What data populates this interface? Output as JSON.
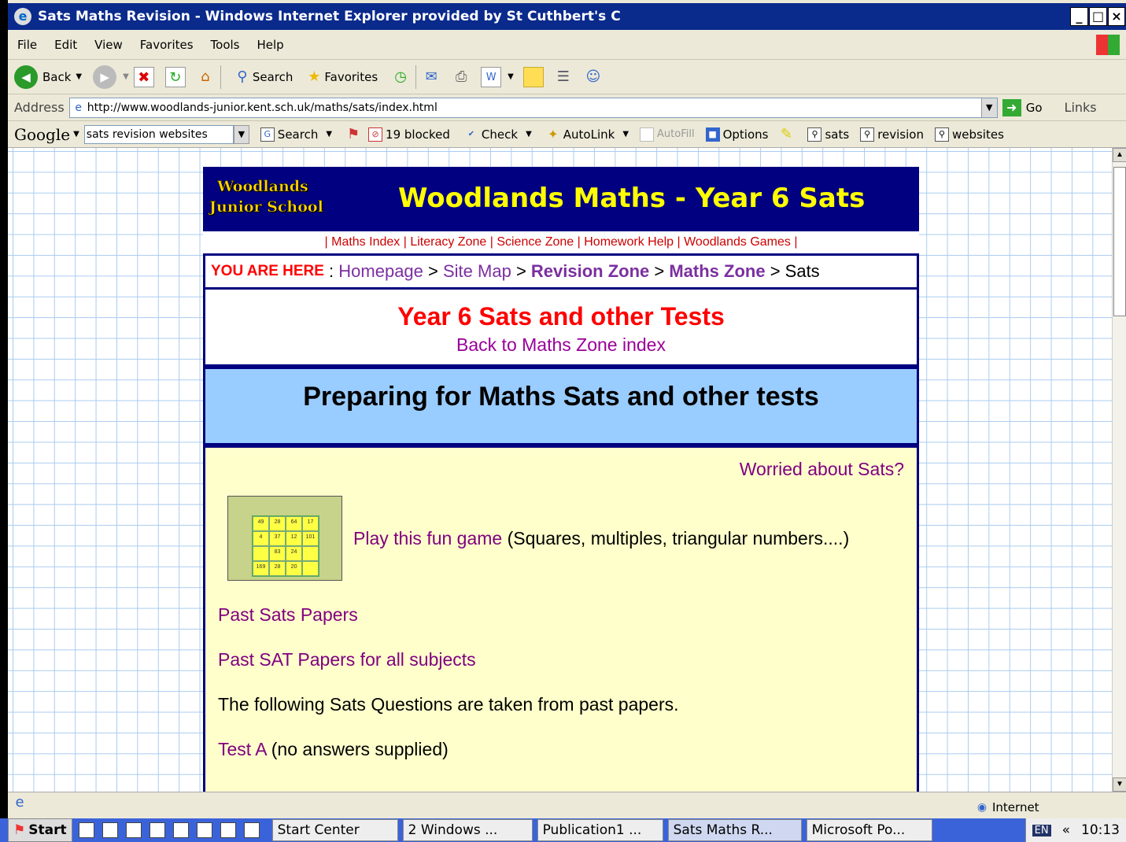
{
  "window": {
    "title": "Sats Maths Revision - Windows Internet Explorer provided by St Cuthbert's C",
    "controls": [
      "_",
      "□",
      "×"
    ]
  },
  "menu": [
    "File",
    "Edit",
    "View",
    "Favorites",
    "Tools",
    "Help"
  ],
  "toolbar": {
    "back": "Back",
    "search": "Search",
    "favorites": "Favorites"
  },
  "address": {
    "label": "Address",
    "url": "http://www.woodlands-junior.kent.sch.uk/maths/sats/index.html",
    "go": "Go",
    "links": "Links"
  },
  "google_bar": {
    "logo": "Google",
    "query": "sats revision websites",
    "search": "Search",
    "blocked": "19 blocked",
    "check": "Check",
    "autolink": "AutoLink",
    "autofill": "AutoFill",
    "options": "Options",
    "highlights": [
      "sats",
      "revision",
      "websites"
    ]
  },
  "page": {
    "logo_line1": "Woodlands",
    "logo_line2": "Junior School",
    "banner_title": "Woodlands Maths - Year 6 Sats",
    "nav": {
      "sep": "|",
      "items": [
        "Maths Index",
        "Literacy Zone",
        "Science Zone",
        "Homework Help",
        "Woodlands Games"
      ]
    },
    "breadcrumb": {
      "label": "YOU ARE HERE",
      "colon": " : ",
      "homepage": "Homepage",
      "site_map": "Site Map",
      "revision_zone": "Revision Zone",
      "maths_zone": "Maths Zone",
      "current": "Sats",
      "sep": " > "
    },
    "title": "Year 6 Sats and other Tests",
    "back_link": "Back to Maths Zone index",
    "heading": "Preparing for Maths Sats and other tests",
    "worried": "Worried about Sats?",
    "game_link": "Play this fun game",
    "game_desc": " (Squares, multiples, triangular numbers....)",
    "game_grid": [
      "49",
      "28",
      "64",
      "17",
      "4",
      "37",
      "12",
      "101",
      "",
      "83",
      "24",
      "",
      "169",
      "28",
      "20",
      ""
    ],
    "past_papers": "Past Sats Papers",
    "past_all": "Past SAT Papers for all subjects",
    "following": "The following Sats Questions are taken from past papers.",
    "test_a": "Test A",
    "test_a_note": " (no answers supplied)"
  },
  "status": {
    "zone": "Internet"
  },
  "taskbar": {
    "start": "Start",
    "tasks": [
      "Start Center",
      "2 Windows ...",
      "Publication1 ...",
      "Sats Maths R...",
      "Microsoft Po..."
    ],
    "lang": "EN",
    "time": "10:13"
  }
}
